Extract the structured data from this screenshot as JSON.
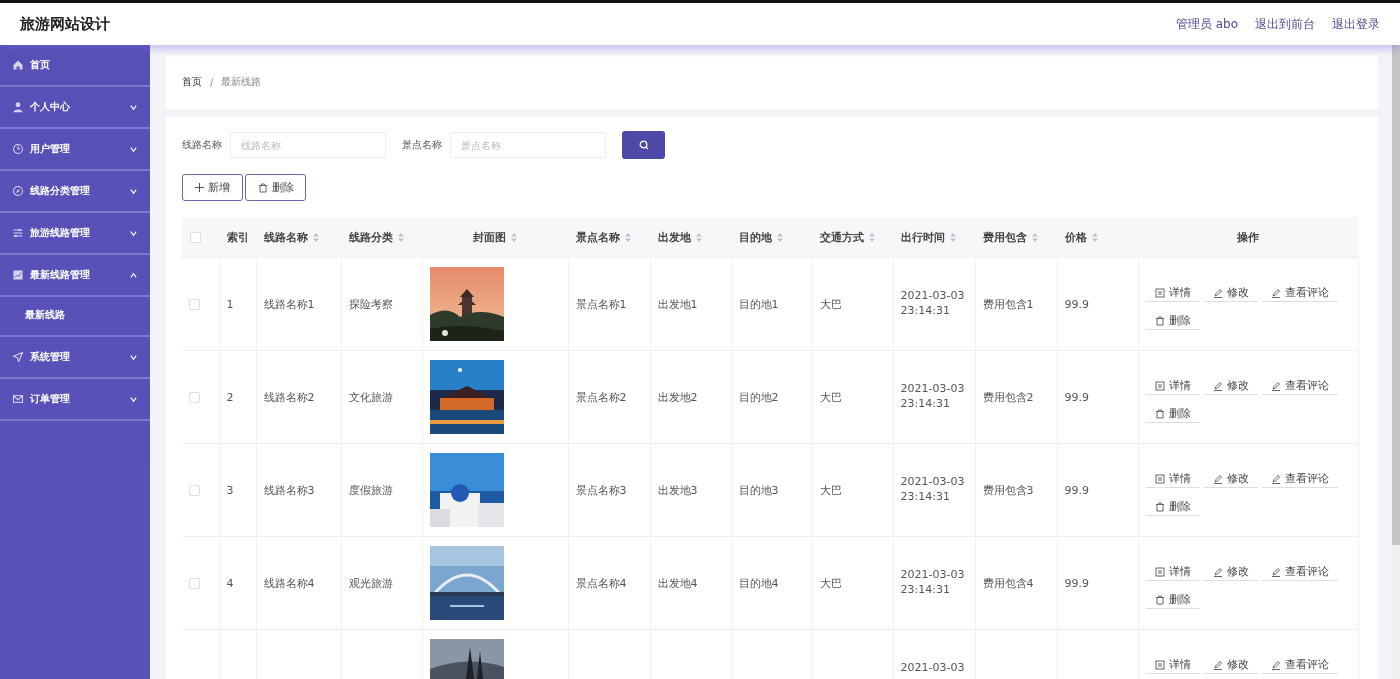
{
  "header": {
    "title": "旅游网站设计",
    "links": [
      "管理员 abo",
      "退出到前台",
      "退出登录"
    ]
  },
  "sidebar": {
    "items": [
      {
        "label": "首页"
      },
      {
        "label": "个人中心",
        "expanded": false
      },
      {
        "label": "用户管理",
        "expanded": false
      },
      {
        "label": "线路分类管理",
        "expanded": false
      },
      {
        "label": "旅游线路管理",
        "expanded": false
      },
      {
        "label": "最新线路管理",
        "expanded": true,
        "children": [
          {
            "label": "最新线路",
            "selected": true
          }
        ]
      },
      {
        "label": "系统管理",
        "expanded": false
      },
      {
        "label": "订单管理",
        "expanded": false
      }
    ]
  },
  "breadcrumb": {
    "items": [
      "首页",
      "最新线路"
    ],
    "separator": "/"
  },
  "search": {
    "fields": [
      {
        "label": "线路名称",
        "placeholder": "线路名称"
      },
      {
        "label": "景点名称",
        "placeholder": "景点名称"
      }
    ]
  },
  "toolbar": [
    {
      "label": "新增",
      "kind": "add"
    },
    {
      "label": "删除",
      "kind": "delete"
    }
  ],
  "table": {
    "header_checked": false,
    "columns": [
      {
        "label": "索引",
        "kind": "plain"
      },
      {
        "label": "线路名称",
        "kind": "sortable"
      },
      {
        "label": "线路分类",
        "kind": "sortable"
      },
      {
        "label": "封面图",
        "kind": "sortable"
      },
      {
        "label": "景点名称",
        "kind": "sortable"
      },
      {
        "label": "出发地",
        "kind": "sortable"
      },
      {
        "label": "目的地",
        "kind": "sortable"
      },
      {
        "label": "交通方式",
        "kind": "sortable"
      },
      {
        "label": "出行时间",
        "kind": "sortable"
      },
      {
        "label": "费用包含",
        "kind": "sortable"
      },
      {
        "label": "价格",
        "kind": "sortable"
      },
      {
        "label": "操作",
        "kind": "plain"
      }
    ],
    "rows": [
      {
        "checked": false,
        "index": "1",
        "name": "线路名称1",
        "category": "探险考察",
        "cover": {
          "kind": "picture"
        },
        "spot": "景点名称1",
        "from": "出发地1",
        "to": "目的地1",
        "transport": "大巴",
        "time": [
          "2021-03-03",
          "23:14:31"
        ],
        "fee": "费用包含1",
        "price": "99.9",
        "actions": [
          {
            "label": "详情",
            "kind": "detail"
          },
          {
            "label": "修改",
            "kind": "edit"
          },
          {
            "label": "查看评论",
            "kind": "edit"
          },
          {
            "label": "删除",
            "kind": "delete"
          }
        ]
      },
      {
        "checked": false,
        "index": "2",
        "name": "线路名称2",
        "category": "文化旅游",
        "cover": {
          "kind": "picture"
        },
        "spot": "景点名称2",
        "from": "出发地2",
        "to": "目的地2",
        "transport": "大巴",
        "time": [
          "2021-03-03",
          "23:14:31"
        ],
        "fee": "费用包含2",
        "price": "99.9",
        "actions": [
          {
            "label": "详情",
            "kind": "detail"
          },
          {
            "label": "修改",
            "kind": "edit"
          },
          {
            "label": "查看评论",
            "kind": "edit"
          },
          {
            "label": "删除",
            "kind": "delete"
          }
        ]
      },
      {
        "checked": false,
        "index": "3",
        "name": "线路名称3",
        "category": "度假旅游",
        "cover": {
          "kind": "picture"
        },
        "spot": "景点名称3",
        "from": "出发地3",
        "to": "目的地3",
        "transport": "大巴",
        "time": [
          "2021-03-03",
          "23:14:31"
        ],
        "fee": "费用包含3",
        "price": "99.9",
        "actions": [
          {
            "label": "详情",
            "kind": "detail"
          },
          {
            "label": "修改",
            "kind": "edit"
          },
          {
            "label": "查看评论",
            "kind": "edit"
          },
          {
            "label": "删除",
            "kind": "delete"
          }
        ]
      },
      {
        "checked": false,
        "index": "4",
        "name": "线路名称4",
        "category": "观光旅游",
        "cover": {
          "kind": "picture"
        },
        "spot": "景点名称4",
        "from": "出发地4",
        "to": "目的地4",
        "transport": "大巴",
        "time": [
          "2021-03-03",
          "23:14:31"
        ],
        "fee": "费用包含4",
        "price": "99.9",
        "actions": [
          {
            "label": "详情",
            "kind": "detail"
          },
          {
            "label": "修改",
            "kind": "edit"
          },
          {
            "label": "查看评论",
            "kind": "edit"
          },
          {
            "label": "删除",
            "kind": "delete"
          }
        ]
      },
      {
        "cover": {
          "kind": "picture"
        },
        "time": [
          "2021-03-03"
        ],
        "actions": [
          {
            "label": "详情",
            "kind": "detail"
          },
          {
            "label": "修改",
            "kind": "edit"
          },
          {
            "label": "查看评论",
            "kind": "edit"
          }
        ]
      }
    ]
  }
}
